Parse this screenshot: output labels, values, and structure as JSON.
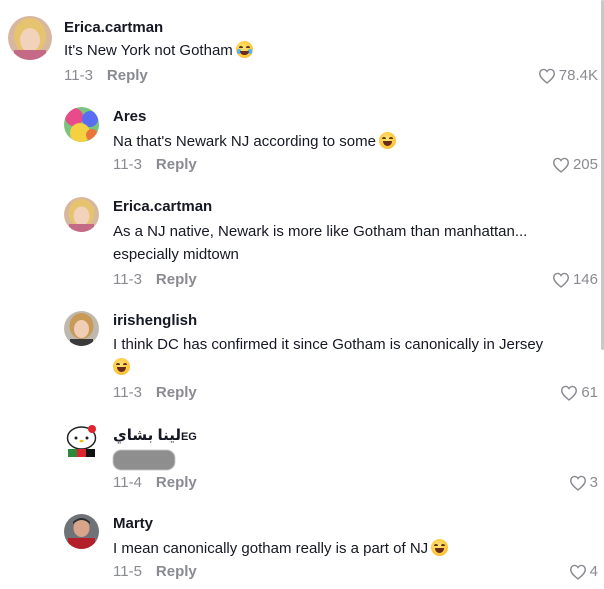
{
  "comments": [
    {
      "author": "Erica.cartman",
      "text": "It's New York not Gotham",
      "emoji": "crying-emoji",
      "date": "11-3",
      "reply": "Reply",
      "likes": "78.4K"
    },
    {
      "author": "Ares",
      "text": "Na that's Newark NJ according to some",
      "emoji": "laughing-emoji",
      "date": "11-3",
      "reply": "Reply",
      "likes": "205"
    },
    {
      "author": "Erica.cartman",
      "text_line1": "As a NJ native, Newark is more like Gotham than manhattan...",
      "text_line2": "especially midtown",
      "date": "11-3",
      "reply": "Reply",
      "likes": "146"
    },
    {
      "author": "irishenglish",
      "text": "I think DC has confirmed it since Gotham is canonically in Jersey",
      "emoji": "laughing-emoji",
      "date": "11-3",
      "reply": "Reply",
      "likes": "61"
    },
    {
      "author": "لينا بشاي",
      "author_suffix": "EG",
      "date": "11-4",
      "reply": "Reply",
      "likes": "3"
    },
    {
      "author": "Marty",
      "text": "I mean canonically gotham really is a part of NJ",
      "emoji": "laughing-emoji",
      "date": "11-5",
      "reply": "Reply",
      "likes": "4"
    }
  ],
  "colors": {
    "text": "#161823",
    "muted": "#8a8b91",
    "background": "#ffffff"
  }
}
